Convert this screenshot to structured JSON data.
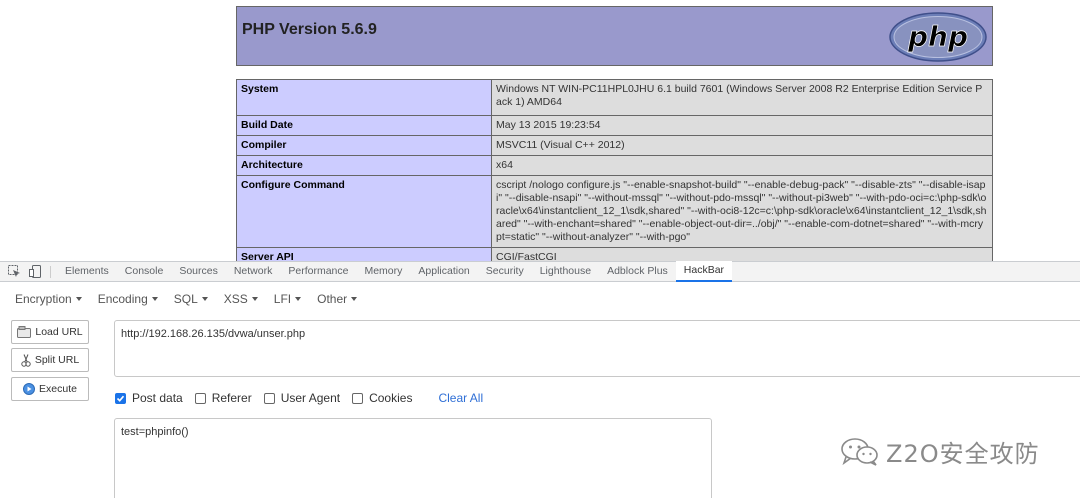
{
  "php": {
    "title": "PHP Version 5.6.9",
    "logo_text": "php",
    "rows": [
      {
        "key": "System",
        "value": "Windows NT WIN-PC11HPL0JHU 6.1 build 7601 (Windows Server 2008 R2 Enterprise Edition Service Pack 1) AMD64"
      },
      {
        "key": "Build Date",
        "value": "May 13 2015 19:23:54"
      },
      {
        "key": "Compiler",
        "value": "MSVC11 (Visual C++ 2012)"
      },
      {
        "key": "Architecture",
        "value": "x64"
      },
      {
        "key": "Configure Command",
        "value": "cscript /nologo configure.js \"--enable-snapshot-build\" \"--enable-debug-pack\" \"--disable-zts\" \"--disable-isapi\" \"--disable-nsapi\" \"--without-mssql\" \"--without-pdo-mssql\" \"--without-pi3web\" \"--with-pdo-oci=c:\\php-sdk\\oracle\\x64\\instantclient_12_1\\sdk,shared\" \"--with-oci8-12c=c:\\php-sdk\\oracle\\x64\\instantclient_12_1\\sdk,shared\" \"--with-enchant=shared\" \"--enable-object-out-dir=../obj/\" \"--enable-com-dotnet=shared\" \"--with-mcrypt=static\" \"--without-analyzer\" \"--with-pgo\""
      },
      {
        "key": "Server API",
        "value": "CGI/FastCGI"
      }
    ]
  },
  "devtools": {
    "tabs": [
      "Elements",
      "Console",
      "Sources",
      "Network",
      "Performance",
      "Memory",
      "Application",
      "Security",
      "Lighthouse",
      "Adblock Plus",
      "HackBar"
    ],
    "active_tab": "HackBar",
    "icons": [
      "inspect-element-icon",
      "device-toolbar-icon"
    ]
  },
  "hackbar": {
    "menu": [
      "Encryption",
      "Encoding",
      "SQL",
      "XSS",
      "LFI",
      "Other"
    ],
    "buttons": {
      "load": "Load URL",
      "split": "Split URL",
      "execute": "Execute"
    },
    "url": "http://192.168.26.135/dvwa/unser.php",
    "options": [
      {
        "label": "Post data",
        "checked": true
      },
      {
        "label": "Referer",
        "checked": false
      },
      {
        "label": "User Agent",
        "checked": false
      },
      {
        "label": "Cookies",
        "checked": false
      }
    ],
    "clear_all": "Clear All",
    "post_data": "test=phpinfo()"
  },
  "watermark": {
    "text": "Z2O安全攻防",
    "icon": "wechat-icon"
  },
  "colors": {
    "php_header": "#9999cc",
    "php_key": "#ccccff",
    "php_value": "#dddddd",
    "accent": "#1a73e8"
  }
}
